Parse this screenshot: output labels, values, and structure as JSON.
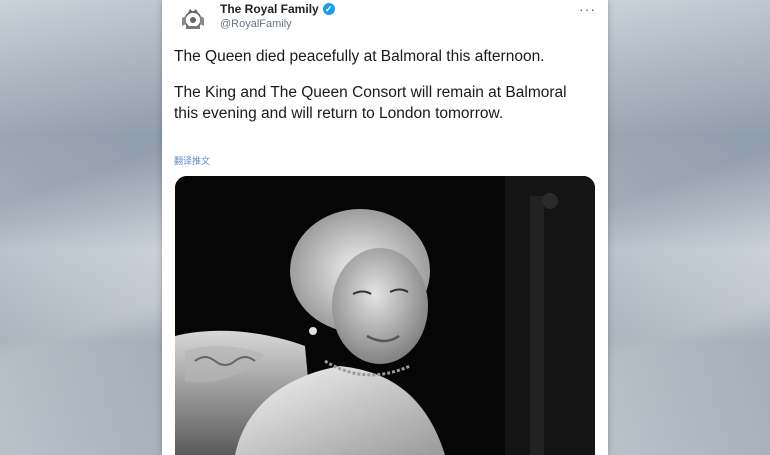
{
  "tweet": {
    "display_name": "The Royal Family",
    "handle": "@RoyalFamily",
    "paragraph_1": "The Queen died peacefully at Balmoral this afternoon.",
    "paragraph_2": "The King and The Queen Consort will remain at Balmoral this evening and will return to London tomorrow.",
    "translate_label": "翻译推文",
    "more_label": "···"
  },
  "colors": {
    "verified": "#1d9bf0",
    "link": "#5b8ec9",
    "text": "#1a1a1a"
  },
  "icons": {
    "avatar": "royal-crest-icon",
    "verified": "verified-badge-icon",
    "more": "more-options-icon"
  }
}
